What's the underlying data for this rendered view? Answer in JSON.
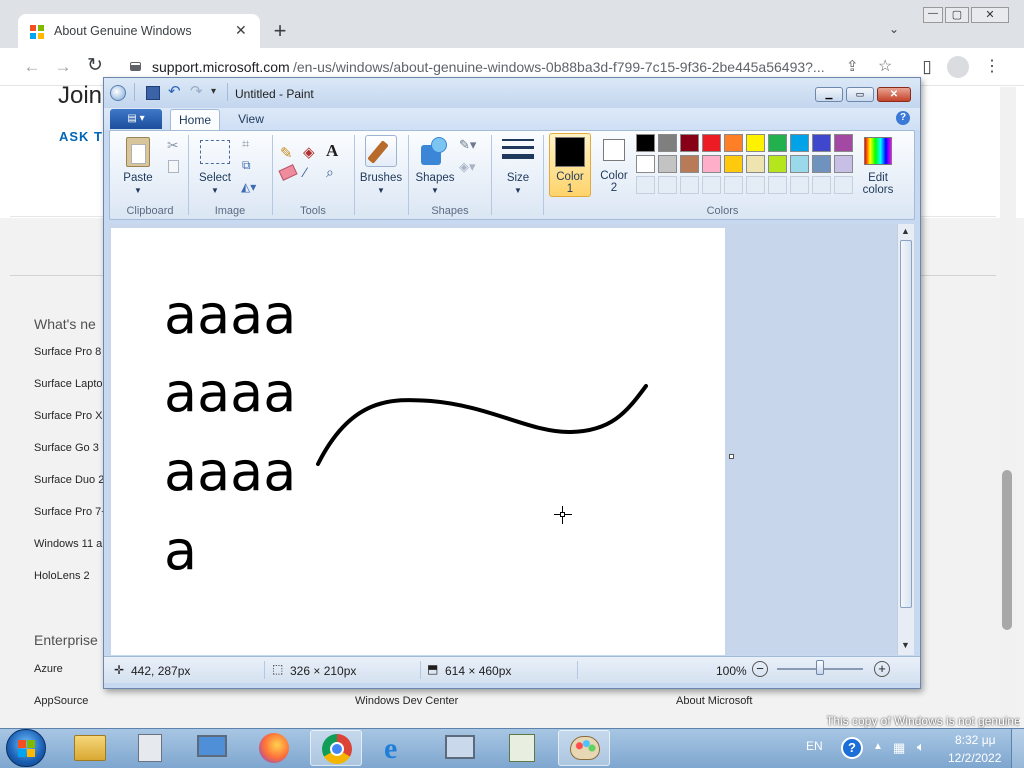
{
  "browser": {
    "tab_title": "About Genuine Windows",
    "new_tab": "+",
    "url_host": "support.microsoft.com",
    "url_path": "/en-us/windows/about-genuine-windows-0b88ba3d-f799-7c15-9f36-2be445a56493?...",
    "window_min": "—",
    "window_max": "▢",
    "window_close": "✕"
  },
  "webpage": {
    "heading_partial": "Join",
    "ask_partial": "ASK TI",
    "whats_new": "What's ne",
    "links": [
      "Surface Pro 8",
      "Surface Laptop",
      "Surface Pro X",
      "Surface Go 3",
      "Surface Duo 2",
      "Surface Pro 7+",
      "Windows 11 a",
      "HoloLens 2"
    ],
    "enterprise": "Enterprise",
    "azure": "Azure",
    "appsource": "AppSource",
    "dev_center": "Windows Dev Center",
    "about_ms": "About Microsoft",
    "genuine_notice": "This copy of Windows is not genuine"
  },
  "paint": {
    "title": "Untitled - Paint",
    "tabs": [
      "Home",
      "View"
    ],
    "groups": {
      "clipboard": "Clipboard",
      "image": "Image",
      "tools": "Tools",
      "shapes": "Shapes",
      "colors": "Colors"
    },
    "buttons": {
      "paste": "Paste",
      "select": "Select",
      "brushes": "Brushes",
      "shapes": "Shapes",
      "size": "Size",
      "color1_a": "Color",
      "color1_b": "1",
      "color2_a": "Color",
      "color2_b": "2",
      "edit_a": "Edit",
      "edit_b": "colors"
    },
    "canvas_text": [
      "aaaa",
      "aaaa",
      "aaaa",
      "a"
    ],
    "status": {
      "cursor_pos": "442, 287px",
      "selection_size": "326 × 210px",
      "image_size": "614 × 460px",
      "zoom": "100%"
    },
    "color1": "#000000",
    "color2": "#ffffff",
    "palette_row1": [
      "#000000",
      "#7f7f7f",
      "#880015",
      "#ed1c24",
      "#ff7f27",
      "#fff200",
      "#22b14c",
      "#00a2e8",
      "#3f48cc",
      "#a349a4"
    ],
    "palette_row2": [
      "#ffffff",
      "#c3c3c3",
      "#b97a57",
      "#ffaec9",
      "#ffc90e",
      "#efe4b0",
      "#b5e61d",
      "#99d9ea",
      "#7092be",
      "#c8bfe7"
    ]
  },
  "taskbar": {
    "lang": "EN",
    "time": "8:32 μμ",
    "date": "12/2/2022",
    "help": "?"
  }
}
